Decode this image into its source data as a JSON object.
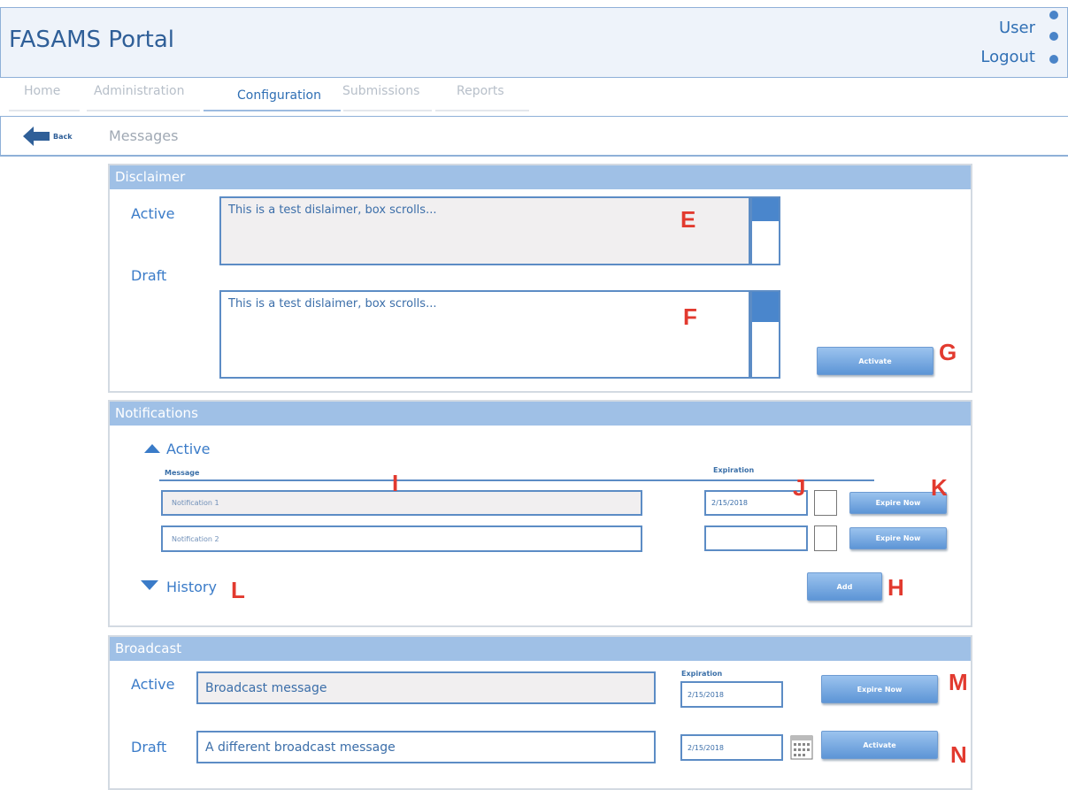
{
  "app": {
    "title": "FASAMS Portal",
    "user_label": "User",
    "logout_label": "Logout"
  },
  "nav": {
    "items": [
      {
        "label": "Home"
      },
      {
        "label": "Administration"
      },
      {
        "label": "Configuration"
      },
      {
        "label": "Submissions"
      },
      {
        "label": "Reports"
      }
    ],
    "active": "Configuration"
  },
  "breadcrumb": {
    "back_label": "Back",
    "title": "Messages"
  },
  "disclaimer": {
    "title": "Disclaimer",
    "active_label": "Active",
    "active_text": "This is a test dislaimer, box scrolls...",
    "draft_label": "Draft",
    "draft_text": "This is a test dislaimer, box scrolls...",
    "activate_label": "Activate"
  },
  "notifications": {
    "title": "Notifications",
    "active_label": "Active",
    "col_message": "Message",
    "col_expiration": "Expiration",
    "rows": [
      {
        "message": "Notification 1",
        "expiration": "2/15/2018",
        "action": "Expire Now"
      },
      {
        "message": "Notification 2",
        "expiration": "",
        "action": "Expire Now"
      }
    ],
    "history_label": "History",
    "add_label": "Add"
  },
  "broadcast": {
    "title": "Broadcast",
    "active_label": "Active",
    "active_text": "Broadcast message",
    "expiration_label": "Expiration",
    "active_expiration": "2/15/2018",
    "expire_label": "Expire Now",
    "draft_label": "Draft",
    "draft_text": "A different broadcast message",
    "draft_expiration": "2/15/2018",
    "activate_label": "Activate"
  },
  "annotations": {
    "e": "E",
    "f": "F",
    "g": "G",
    "h": "H",
    "i": "I",
    "j": "J",
    "k": "K",
    "l": "L",
    "m": "M",
    "n": "N"
  },
  "colors": {
    "panel_header": "#9fc0e6",
    "field_border": "#5c8cc5",
    "annotation": "#e23a2f",
    "button_top": "#9bc3ee",
    "button_bottom": "#5d95d6"
  }
}
